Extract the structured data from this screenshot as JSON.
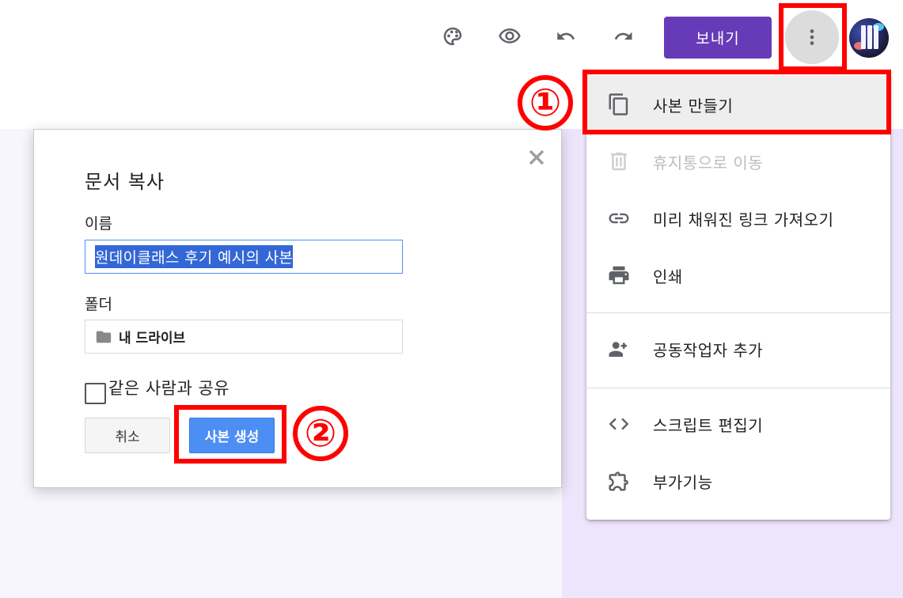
{
  "toolbar": {
    "icons": [
      "palette-icon",
      "eye-icon",
      "undo-icon",
      "redo-icon"
    ],
    "send_label": "보내기",
    "more_icon": "more-vert-icon",
    "send_color": "#673ab7"
  },
  "menu": {
    "items": [
      {
        "label": "사본 만들기",
        "icon": "copy-icon",
        "state": "hover"
      },
      {
        "label": "휴지통으로 이동",
        "icon": "trash-icon",
        "state": "disabled"
      },
      {
        "label": "미리 채워진 링크 가져오기",
        "icon": "link-icon",
        "state": "normal"
      },
      {
        "label": "인쇄",
        "icon": "print-icon",
        "state": "normal"
      },
      {
        "label": "공동작업자 추가",
        "icon": "add-people-icon",
        "state": "normal"
      },
      {
        "label": "스크립트 편집기",
        "icon": "code-icon",
        "state": "normal"
      },
      {
        "label": "부가기능",
        "icon": "puzzle-icon",
        "state": "normal"
      }
    ]
  },
  "dialog": {
    "title": "문서 복사",
    "name_label": "이름",
    "name_value": "원데이클래스 후기 예시의 사본",
    "folder_label": "폴더",
    "folder_value": "내 드라이브",
    "share_label": "같은 사람과 공유",
    "share_checked": false,
    "cancel_label": "취소",
    "create_label": "사본 생성"
  },
  "annotations": {
    "step1": "①",
    "step2": "②",
    "color": "#ff0000"
  },
  "colors": {
    "accent": "#673ab7",
    "primary_button": "#4d8ef3",
    "selection": "#3367d6",
    "page_bg": "#ede5fb"
  }
}
